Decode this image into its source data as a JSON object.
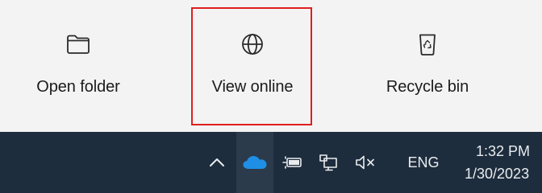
{
  "flyout": {
    "actions": [
      {
        "label": "Open folder",
        "icon": "folder-icon"
      },
      {
        "label": "View online",
        "icon": "globe-icon"
      },
      {
        "label": "Recycle bin",
        "icon": "recycle-bin-icon"
      }
    ],
    "highlighted_action": "View online",
    "highlight_color": "#e01e1e"
  },
  "taskbar": {
    "background": "#1e2d3d",
    "tray_icons": [
      "show-hidden-icons-chevron-icon",
      "onedrive-cloud-icon",
      "battery-charging-icon",
      "network-icon",
      "volume-muted-icon"
    ],
    "onedrive_color": "#1f8fe5",
    "language": "ENG",
    "clock": {
      "time": "1:32 PM",
      "date": "1/30/2023"
    }
  }
}
